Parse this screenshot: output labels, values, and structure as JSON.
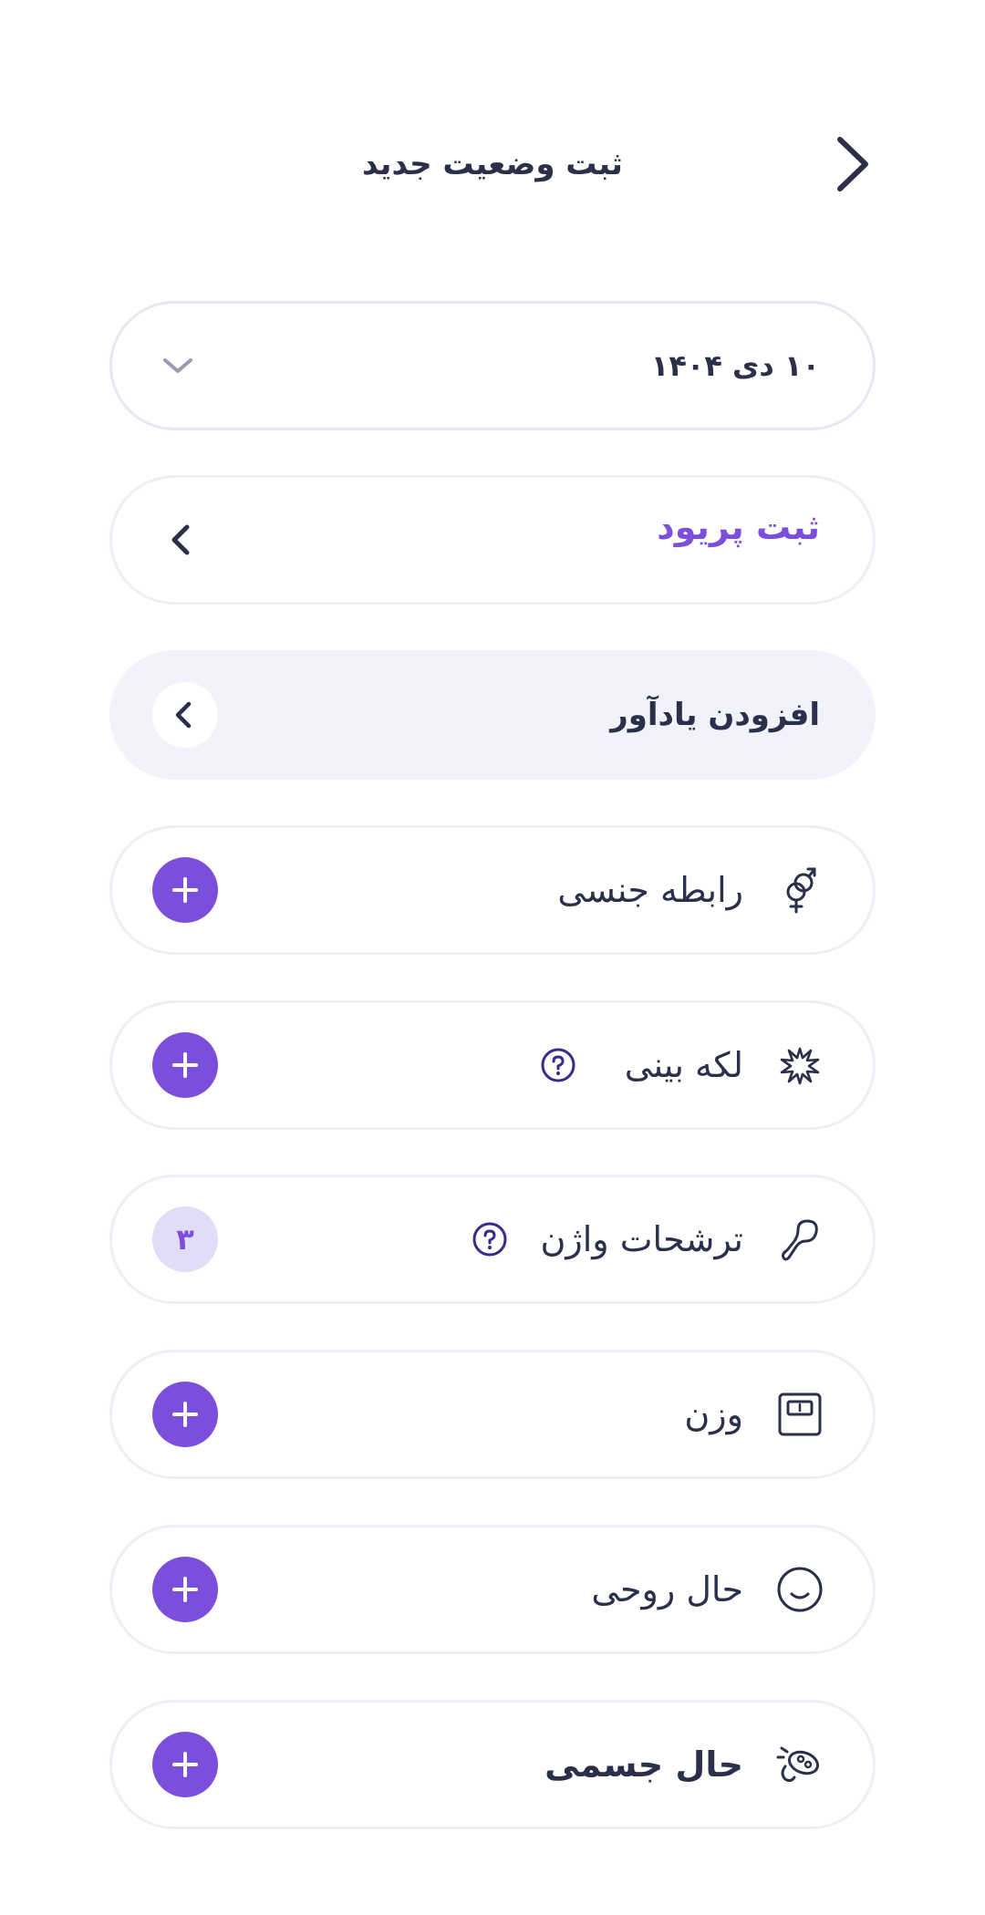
{
  "header": {
    "title": "ثبت وضعیت جدید",
    "back_icon": "chevron-right-icon"
  },
  "date_select": {
    "value": "۱۰ دی ۱۴۰۴",
    "icon": "chevron-down-icon"
  },
  "period": {
    "label": "ثبت پریود",
    "icon": "chevron-left-icon"
  },
  "reminder": {
    "label": "افزودن یادآور",
    "icon": "chevron-left-icon"
  },
  "items": [
    {
      "label": "رابطه جنسی",
      "icon": "gender-icon",
      "action": "add"
    },
    {
      "label": "لکه بینی",
      "icon": "splatter-icon",
      "help": true,
      "action": "add"
    },
    {
      "label": "ترشحات واژن",
      "icon": "discharge-icon",
      "help": true,
      "count": "۳"
    },
    {
      "label": "وزن",
      "icon": "scale-icon",
      "action": "add"
    },
    {
      "label": "حال روحی",
      "icon": "mood-icon",
      "action": "add"
    },
    {
      "label": "حال جسمی",
      "icon": "body-condition-icon",
      "action": "add"
    }
  ],
  "colors": {
    "accent": "#7b4fdc",
    "text": "#2b2f4a",
    "badge_bg": "#e2dcf7",
    "reminder_bg": "#f1f2fa"
  }
}
